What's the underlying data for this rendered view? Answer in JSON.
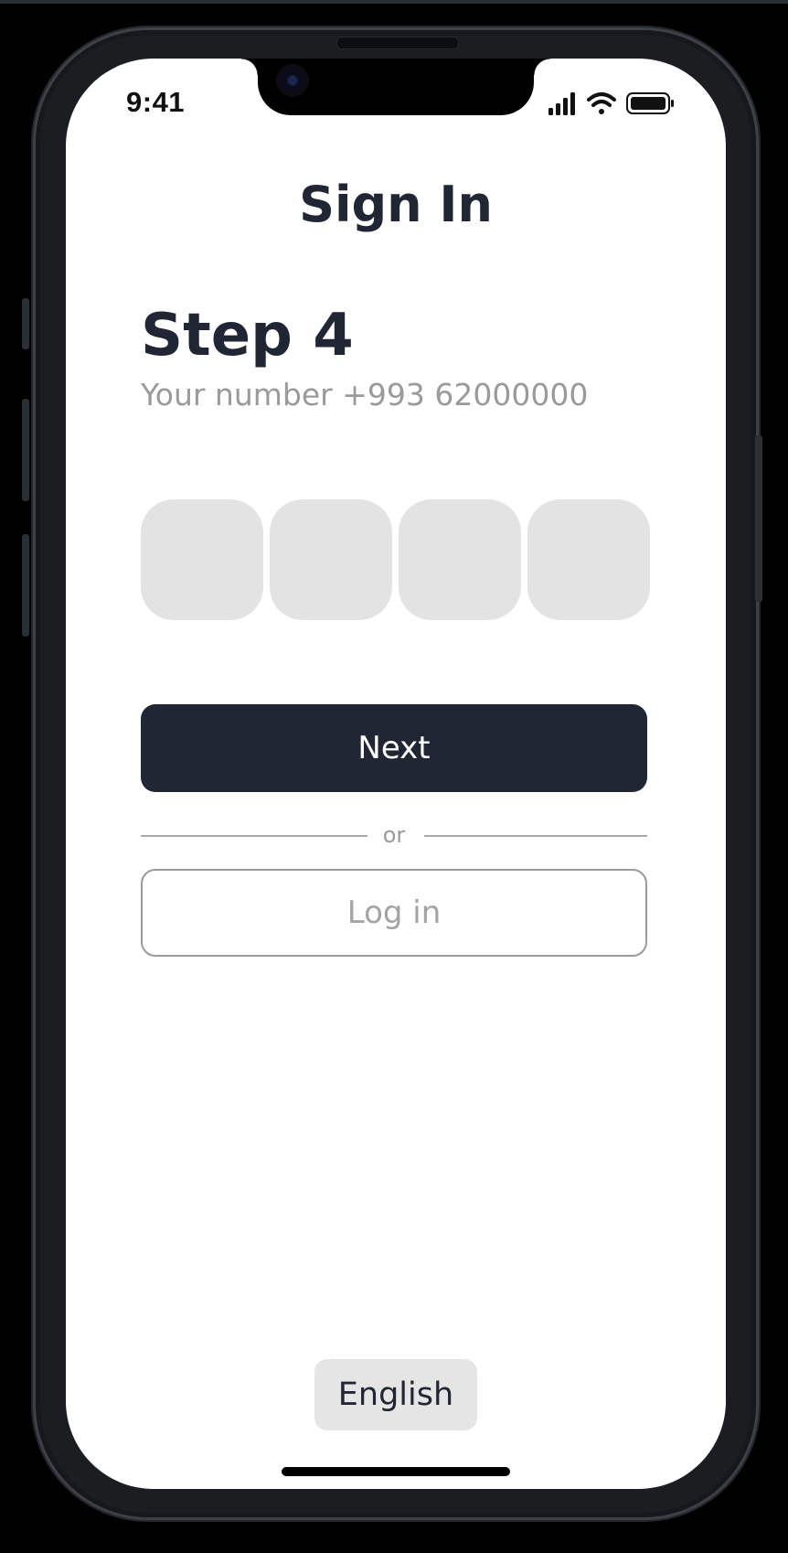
{
  "status_bar": {
    "time": "9:41",
    "signal_icon": "cellular-signal-icon",
    "wifi_icon": "wifi-icon",
    "battery_icon": "battery-icon"
  },
  "screen": {
    "title": "Sign In",
    "step_label": "Step 4",
    "subtitle": "Your number +993 62000000",
    "code_digits": [
      "",
      "",
      "",
      ""
    ],
    "next_label": "Next",
    "or_label": "or",
    "login_label": "Log in",
    "language_label": "English"
  },
  "colors": {
    "primary": "#212634",
    "otp_box": "#e3e3e3",
    "muted_text": "#9a9a9a",
    "language_button": "#e5e5e5"
  }
}
